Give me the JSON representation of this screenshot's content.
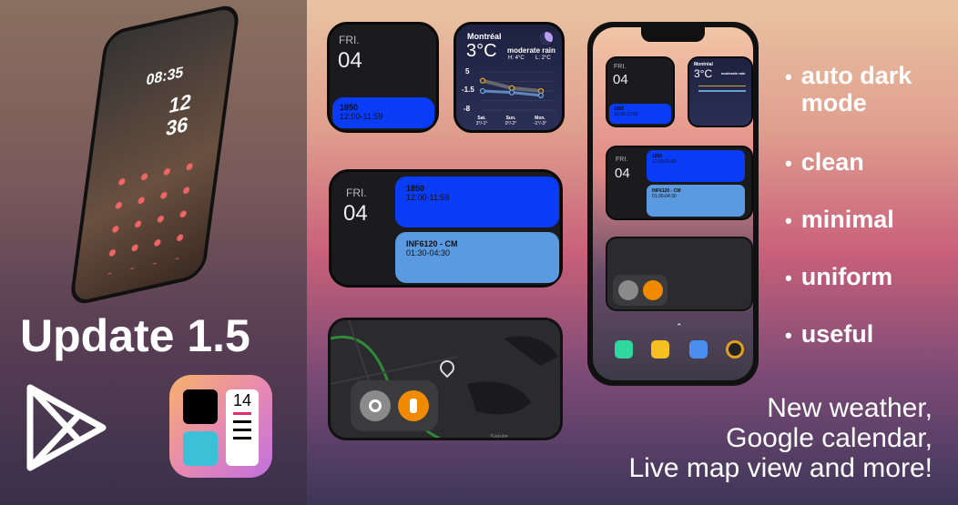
{
  "promo": {
    "title": "Update 1.5",
    "tagline": [
      "New weather,",
      "Google calendar,",
      "Live map view and more!"
    ],
    "features": [
      "auto dark mode",
      "clean",
      "minimal",
      "uniform",
      "useful"
    ]
  },
  "left_phone": {
    "clock_time": "08:35",
    "big_clock": "12 36"
  },
  "app_icon": {
    "number": "14"
  },
  "calendar_small": {
    "day": "FRI.",
    "date": "04",
    "events": [
      {
        "title": "1850",
        "time": "12:00-11:59"
      }
    ]
  },
  "calendar_wide": {
    "day": "FRI.",
    "date": "04",
    "events": [
      {
        "title": "1850",
        "time": "12:00-11:59"
      },
      {
        "title": "INF6120 - CM",
        "time": "01:30-04:30"
      }
    ]
  },
  "weather": {
    "city": "Montréal",
    "temp": "3°C",
    "condition": "moderate rain",
    "high": "H: 4°C",
    "low": "L: 2°C",
    "y_ticks": [
      "5",
      "-1.5",
      "-8"
    ],
    "days": [
      {
        "name": "Sat.",
        "range": "3°/-1°"
      },
      {
        "name": "Sun.",
        "range": "0°/-2°"
      },
      {
        "name": "Mon.",
        "range": "-1°/-3°"
      }
    ],
    "high_series": [
      2,
      -0.5,
      -1.5
    ],
    "low_series": [
      -1.5,
      -2,
      -3
    ],
    "colors": {
      "high": "#e0a020",
      "low": "#6aa0d8"
    }
  },
  "map_widget": {
    "icons": [
      "search-icon",
      "traffic-light-icon"
    ],
    "label": "Sainte"
  },
  "colors": {
    "event_primary": "#0a3cf5",
    "event_secondary": "#5a9ae0",
    "traffic": "#f08a00"
  }
}
